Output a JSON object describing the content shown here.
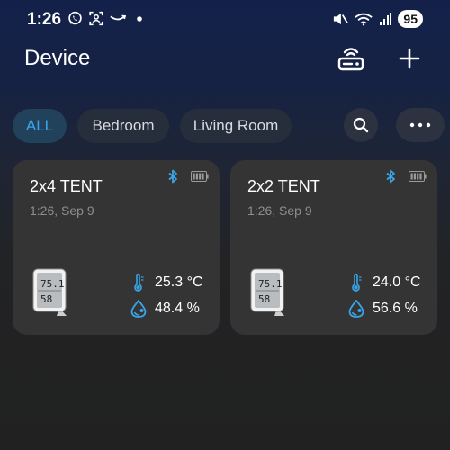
{
  "status_bar": {
    "time": "1:26",
    "battery": "95",
    "signal_label": "5"
  },
  "header": {
    "title": "Device"
  },
  "filters": [
    {
      "label": "ALL",
      "active": true
    },
    {
      "label": "Bedroom",
      "active": false
    },
    {
      "label": "Living Room",
      "active": false
    }
  ],
  "devices": [
    {
      "name": "2x4 TENT",
      "updated": "1:26, Sep 9",
      "temperature": "25.3 °C",
      "humidity": "48.4 %"
    },
    {
      "name": "2x2 TENT",
      "updated": "1:26, Sep 9",
      "temperature": "24.0 °C",
      "humidity": "56.6 %"
    }
  ],
  "colors": {
    "accent": "#3aa4e8",
    "card": "#343434",
    "chip": "#262d3b",
    "active_chip": "#22415a"
  },
  "icons": {
    "header": [
      "hub-icon",
      "plus-icon"
    ],
    "filters": [
      "search-icon",
      "more-icon"
    ],
    "card": [
      "bluetooth-icon",
      "battery-icon",
      "thermometer-icon",
      "humidity-icon",
      "hygrometer-device-icon"
    ]
  }
}
